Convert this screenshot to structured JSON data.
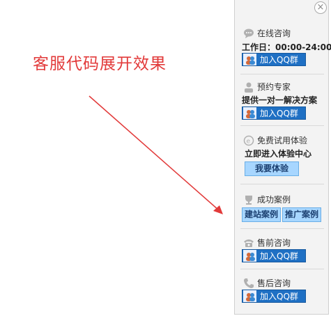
{
  "annotation": "客服代码展开效果",
  "panel": {
    "close_icon": "close-icon",
    "online": {
      "title": "在线咨询",
      "hours": "工作日：00:00-24:00",
      "qq_label": "加入QQ群"
    },
    "expert": {
      "title": "预约专家",
      "desc": "提供一对一解决方案",
      "qq_label": "加入QQ群"
    },
    "trial": {
      "title": "免费试用体验",
      "desc": "立即进入体验中心",
      "button": "我要体验"
    },
    "cases": {
      "title": "成功案例",
      "site_button": "建站案例",
      "promo_button": "推广案例"
    },
    "presale": {
      "title": "售前咨询",
      "qq_label": "加入QQ群"
    },
    "aftersale": {
      "title": "售后咨询",
      "qq_label": "加入QQ群"
    }
  },
  "colors": {
    "annotation": "#e23a3a",
    "qq_button": "#1f70c4",
    "light_button": "#a7d6ff"
  }
}
